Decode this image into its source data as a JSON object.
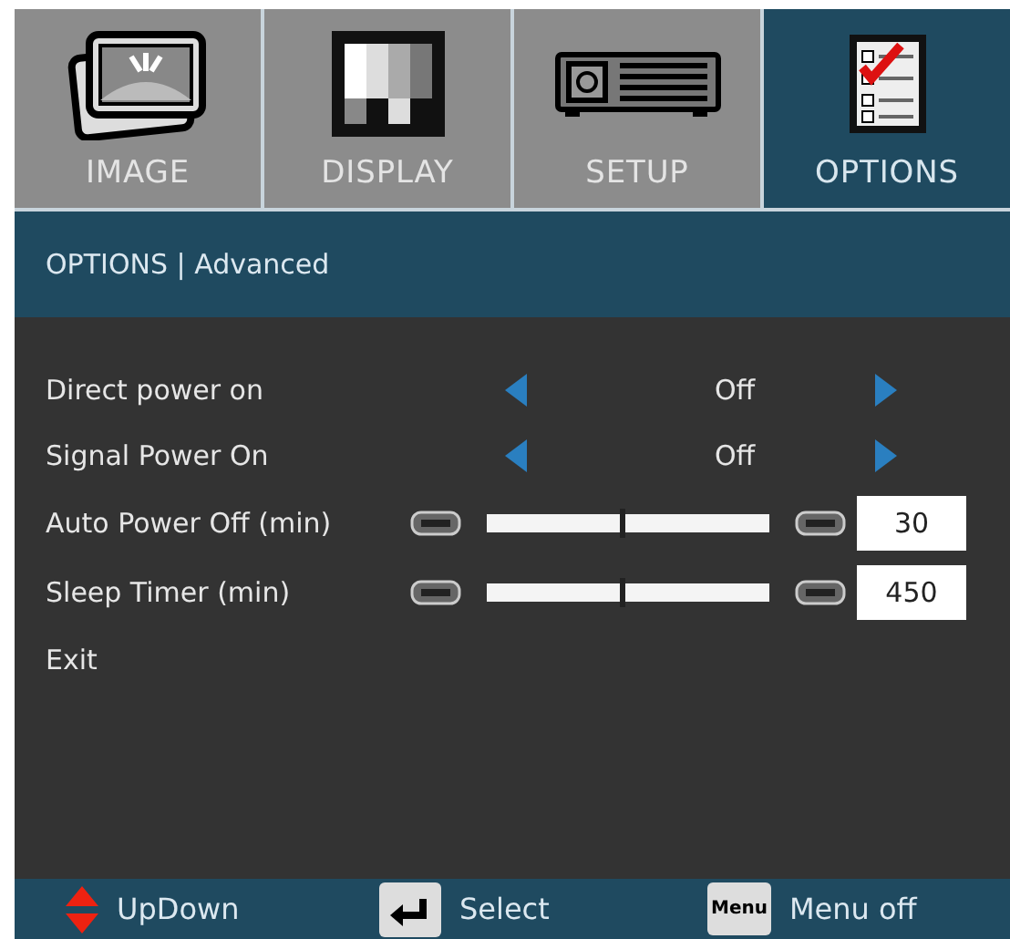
{
  "tabs": [
    {
      "label": "IMAGE",
      "kind": "image",
      "selected": false
    },
    {
      "label": "DISPLAY",
      "kind": "display",
      "selected": false
    },
    {
      "label": "SETUP",
      "kind": "setup",
      "selected": false
    },
    {
      "label": "OPTIONS",
      "kind": "options",
      "selected": true
    }
  ],
  "breadcrumb": "OPTIONS | Advanced",
  "items": [
    {
      "kind": "option",
      "label": "Direct power on",
      "value": "Off"
    },
    {
      "kind": "option",
      "label": "Signal Power On",
      "value": "Off"
    },
    {
      "kind": "slider",
      "label": "Auto Power Off (min)",
      "level": 0.47,
      "value": "30"
    },
    {
      "kind": "slider",
      "label": "Sleep Timer (min)",
      "level": 0.47,
      "value": "450"
    },
    {
      "kind": "action",
      "label": "Exit"
    }
  ],
  "footer": [
    {
      "kind": "updown",
      "label": "UpDown"
    },
    {
      "kind": "enter",
      "label": "Select"
    },
    {
      "kind": "menu",
      "key": "Menu",
      "label": "Menu off"
    }
  ]
}
